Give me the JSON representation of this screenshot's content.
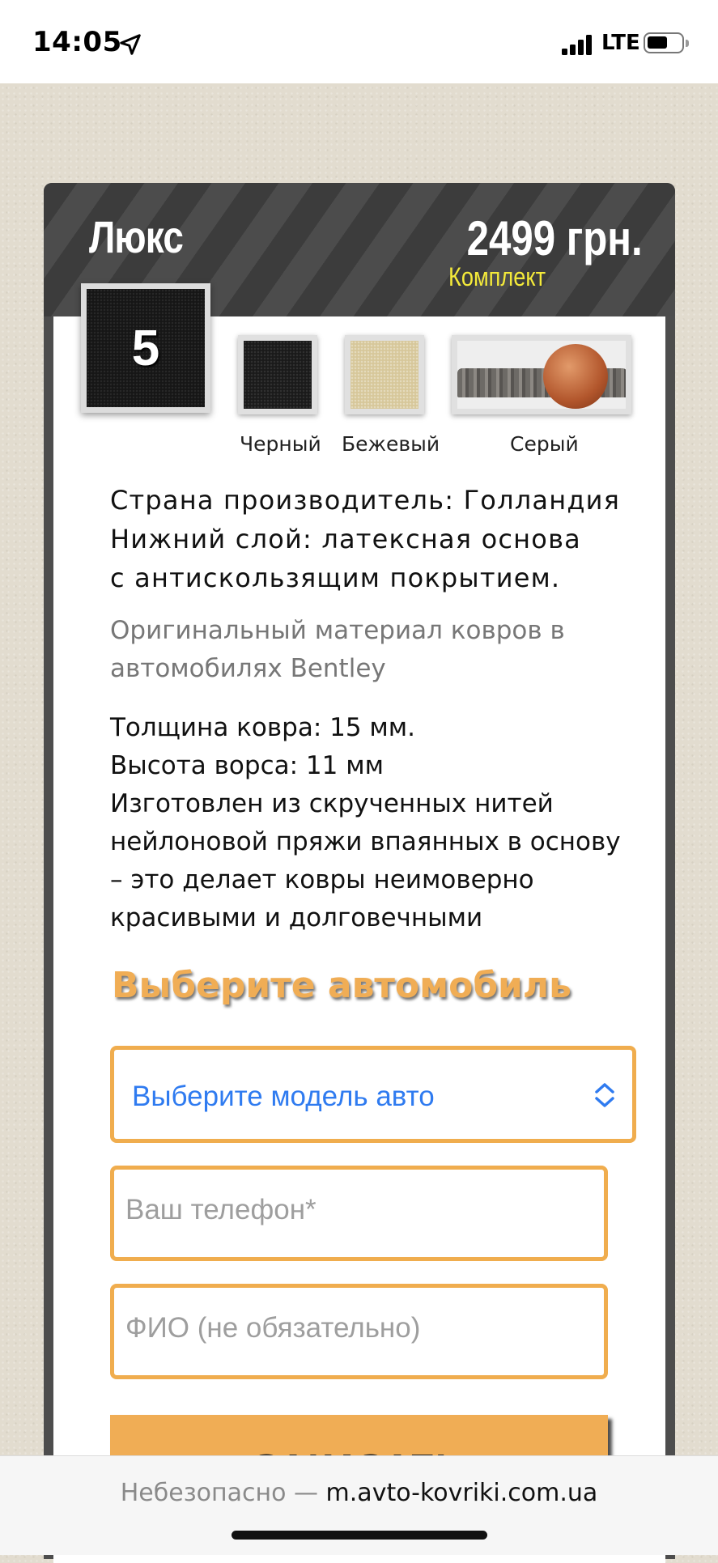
{
  "status_bar": {
    "time": "14:05",
    "network": "LTE"
  },
  "product": {
    "title": "Люкс",
    "price": "2499 грн.",
    "price_note": "Комплект",
    "number_badge": "5",
    "colors": [
      {
        "label": "Черный",
        "swatch": "#1a1a1a"
      },
      {
        "label": "Бежевый",
        "swatch": "#d7c79a"
      },
      {
        "label": "Серый",
        "swatch": "#8c8883"
      }
    ],
    "specs": [
      "Страна производитель: Голландия",
      "Нижний слой: латексная основа",
      "с антискользящим покрытием."
    ],
    "original_material": [
      "Оригинальный материал ковров в",
      "автомобилях Bentley"
    ],
    "details": [
      "Толщина ковра: 15 мм.",
      "Высота ворса: 11 мм",
      "Изготовлен из скрученных нитей",
      "нейлоновой пряжи впаянных в основу",
      "– это делает ковры неимоверно",
      "красивыми и долговечными"
    ]
  },
  "order_form": {
    "heading": "Выберите автомобиль",
    "car_select_value": "Выберите модель авто",
    "phone_placeholder": "Ваш телефон*",
    "name_placeholder": "ФИО (не обязательно)",
    "submit_label": "ЗАКАЗАТЬ"
  },
  "browser": {
    "security_label": "Небезопасно —",
    "host": "m.avto-kovriki.com.ua"
  },
  "colors": {
    "accent": "#f0ad4e",
    "price_note": "#f4ea3a",
    "select_text": "#2f7bf0"
  }
}
